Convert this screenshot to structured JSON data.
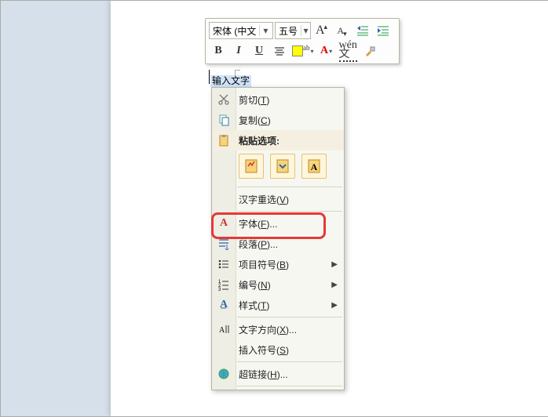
{
  "selection_text": "输入文字",
  "toolbar": {
    "font_name": "宋体 (中文",
    "font_size": "五号",
    "grow_label": "A",
    "shrink_label": "A",
    "bold": "B",
    "italic": "I",
    "underline": "U"
  },
  "context_menu": {
    "cut": {
      "label": "剪切",
      "key": "T"
    },
    "copy": {
      "label": "复制",
      "key": "C"
    },
    "paste_heading": "粘贴选项:",
    "reconvert": {
      "label": "汉字重选",
      "key": "V"
    },
    "font": {
      "label": "字体",
      "key": "F",
      "suffix": "..."
    },
    "paragraph": {
      "label": "段落",
      "key": "P",
      "suffix": "..."
    },
    "bullets": {
      "label": "项目符号",
      "key": "B"
    },
    "numbering": {
      "label": "编号",
      "key": "N"
    },
    "styles": {
      "label": "样式",
      "key": "T"
    },
    "text_direction": {
      "label": "文字方向",
      "key": "X",
      "suffix": "..."
    },
    "insert_symbol": {
      "label": "插入符号",
      "key": "S"
    },
    "hyperlink": {
      "label": "超链接",
      "key": "H",
      "suffix": "..."
    }
  }
}
